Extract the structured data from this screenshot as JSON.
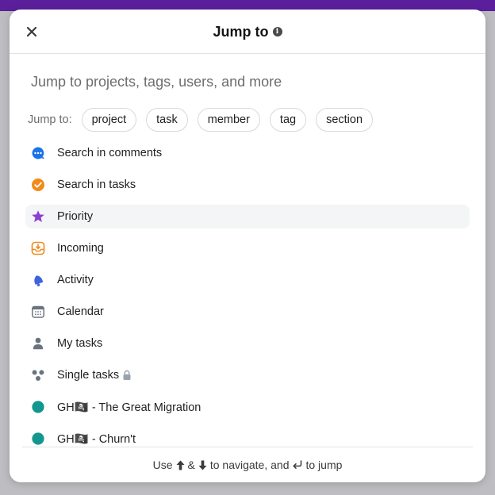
{
  "modal": {
    "title": "Jump to",
    "search": {
      "placeholder": "Jump to projects, tags, users, and more",
      "value": ""
    },
    "filters": {
      "label": "Jump to:",
      "chips": [
        "project",
        "task",
        "member",
        "tag",
        "section"
      ]
    },
    "items": [
      {
        "label": "Search in comments",
        "icon": "comment-bubble-icon",
        "color": "#1a73e8"
      },
      {
        "label": "Search in tasks",
        "icon": "check-circle-icon",
        "color": "#f08c1a"
      },
      {
        "label": "Priority",
        "icon": "star-icon",
        "color": "#8a3fd1"
      },
      {
        "label": "Incoming",
        "icon": "inbox-icon",
        "color": "#ef8a1f"
      },
      {
        "label": "Activity",
        "icon": "bell-icon",
        "color": "#3e63dd"
      },
      {
        "label": "Calendar",
        "icon": "calendar-icon",
        "color": "#6a7480"
      },
      {
        "label": "My tasks",
        "icon": "person-icon",
        "color": "#6a7480"
      },
      {
        "label": "Single tasks",
        "icon": "dots-icon",
        "color": "#6a7480"
      },
      {
        "label": "GH🏴‍☠️ - The Great Migration",
        "icon": "project-dot-icon",
        "color": "#13968e"
      },
      {
        "label": "GH🏴‍☠️ - Churn't",
        "icon": "project-dot-icon",
        "color": "#13968e"
      }
    ],
    "footer": {
      "prefix": "Use",
      "amp": "&",
      "middle": "to navigate, and",
      "suffix": "to jump"
    }
  },
  "colors": {
    "accent_bar": "#5b1f9b",
    "active_row": "#f4f5f6"
  }
}
